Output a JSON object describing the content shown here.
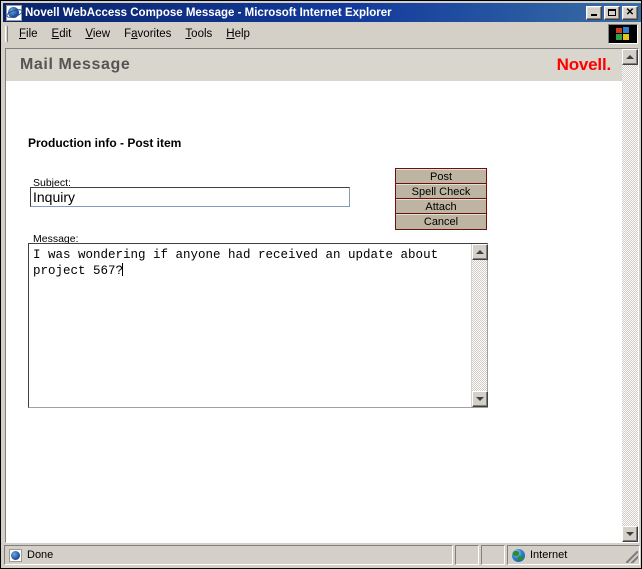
{
  "window": {
    "title": "Novell WebAccess Compose Message - Microsoft Internet Explorer",
    "icon": "ie-document-icon",
    "controls": {
      "minimize": "_",
      "maximize": "□",
      "close": "✕"
    }
  },
  "menubar": {
    "items": [
      {
        "label": "File",
        "accel": "F"
      },
      {
        "label": "Edit",
        "accel": "E"
      },
      {
        "label": "View",
        "accel": "V"
      },
      {
        "label": "Favorites",
        "accel": "a"
      },
      {
        "label": "Tools",
        "accel": "T"
      },
      {
        "label": "Help",
        "accel": "H"
      }
    ],
    "logo": "ie-animated-logo"
  },
  "page": {
    "header": {
      "title": "Mail Message",
      "brand": "Novell.",
      "brand_color": "#ff0000",
      "band_color": "#d9d6cd"
    },
    "section_heading": "Production info - Post item",
    "form": {
      "subject": {
        "label": "Subject:",
        "value": "Inquiry",
        "placeholder": ""
      },
      "message": {
        "label": "Message:",
        "value": "I was wondering if anyone had received an update about project 567?"
      }
    },
    "buttons": [
      {
        "label": "Post",
        "name": "post-button"
      },
      {
        "label": "Spell Check",
        "name": "spell-check-button"
      },
      {
        "label": "Attach",
        "name": "attach-button"
      },
      {
        "label": "Cancel",
        "name": "cancel-button"
      }
    ],
    "button_style": {
      "face": "#bdb5a1",
      "border": "#6b0f0f"
    }
  },
  "statusbar": {
    "status": "Done",
    "zone": "Internet",
    "status_icon": "ie-document-icon",
    "zone_icon": "globe-icon"
  }
}
